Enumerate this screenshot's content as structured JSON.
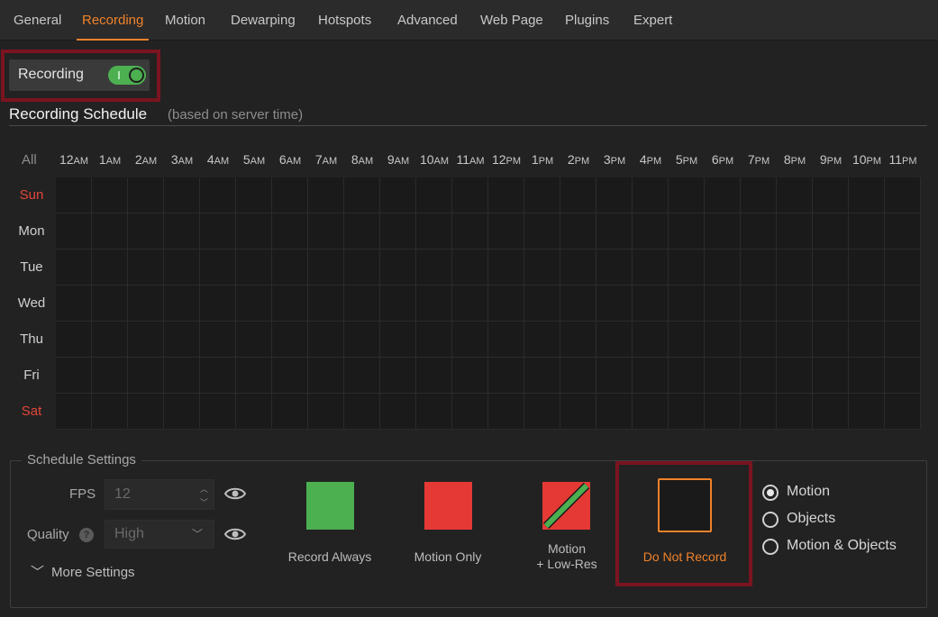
{
  "tabs": [
    "General",
    "Recording",
    "Motion",
    "Dewarping",
    "Hotspots",
    "Advanced",
    "Web Page",
    "Plugins",
    "Expert"
  ],
  "active_tab": "Recording",
  "recording_toggle": {
    "label": "Recording",
    "on": true
  },
  "schedule": {
    "title": "Recording Schedule",
    "note": "(based on server time)",
    "all_label": "All",
    "hours": [
      {
        "n": "12",
        "s": "AM"
      },
      {
        "n": "1",
        "s": "AM"
      },
      {
        "n": "2",
        "s": "AM"
      },
      {
        "n": "3",
        "s": "AM"
      },
      {
        "n": "4",
        "s": "AM"
      },
      {
        "n": "5",
        "s": "AM"
      },
      {
        "n": "6",
        "s": "AM"
      },
      {
        "n": "7",
        "s": "AM"
      },
      {
        "n": "8",
        "s": "AM"
      },
      {
        "n": "9",
        "s": "AM"
      },
      {
        "n": "10",
        "s": "AM"
      },
      {
        "n": "11",
        "s": "AM"
      },
      {
        "n": "12",
        "s": "PM"
      },
      {
        "n": "1",
        "s": "PM"
      },
      {
        "n": "2",
        "s": "PM"
      },
      {
        "n": "3",
        "s": "PM"
      },
      {
        "n": "4",
        "s": "PM"
      },
      {
        "n": "5",
        "s": "PM"
      },
      {
        "n": "6",
        "s": "PM"
      },
      {
        "n": "7",
        "s": "PM"
      },
      {
        "n": "8",
        "s": "PM"
      },
      {
        "n": "9",
        "s": "PM"
      },
      {
        "n": "10",
        "s": "PM"
      },
      {
        "n": "11",
        "s": "PM"
      }
    ],
    "days": [
      {
        "label": "Sun",
        "weekend": true
      },
      {
        "label": "Mon",
        "weekend": false
      },
      {
        "label": "Tue",
        "weekend": false
      },
      {
        "label": "Wed",
        "weekend": false
      },
      {
        "label": "Thu",
        "weekend": false
      },
      {
        "label": "Fri",
        "weekend": false
      },
      {
        "label": "Sat",
        "weekend": true
      }
    ],
    "cell_mode": "Do Not Record"
  },
  "settings": {
    "title": "Schedule Settings",
    "fps_label": "FPS",
    "fps_value": "12",
    "quality_label": "Quality",
    "quality_value": "High",
    "help_glyph": "?",
    "more_settings": "More Settings"
  },
  "legend": [
    {
      "label": "Record Always",
      "color": "#4caf50"
    },
    {
      "label": "Motion Only",
      "color": "#e53935"
    },
    {
      "label": "Motion\n+ Low-Res",
      "color": "#e53935",
      "stripe": "#4caf50"
    },
    {
      "label": "Do Not Record",
      "color": "#1a1a1a",
      "selected": true
    }
  ],
  "motion_types": [
    {
      "label": "Motion",
      "checked": true
    },
    {
      "label": "Objects",
      "checked": false
    },
    {
      "label": "Motion & Objects",
      "checked": false
    }
  ],
  "colors": {
    "accent": "#f0822a",
    "weekend": "#e2463a",
    "highlight_border": "#7a1420"
  }
}
